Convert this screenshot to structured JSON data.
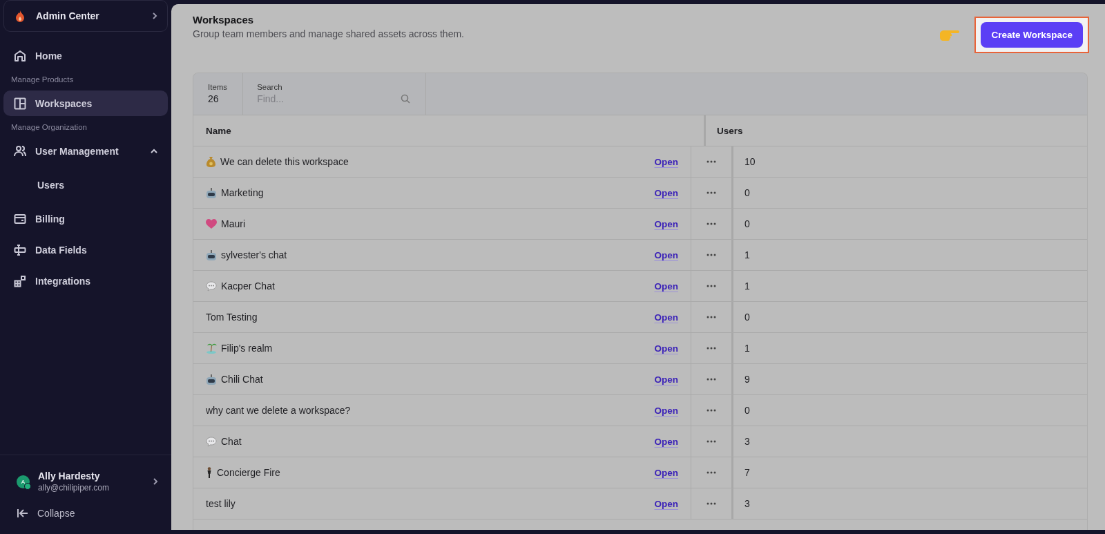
{
  "sidebar": {
    "title": "Admin Center",
    "items": [
      {
        "kind": "home",
        "label": "Home",
        "selected": false
      },
      {
        "kind": "section",
        "label": "Manage Products"
      },
      {
        "kind": "workspaces",
        "label": "Workspaces",
        "selected": true
      },
      {
        "kind": "section",
        "label": "Manage Organization"
      },
      {
        "kind": "users",
        "label": "User Management",
        "selected": false,
        "expanded": true,
        "children": [
          {
            "label": "Users",
            "selected": false
          }
        ]
      },
      {
        "kind": "billing",
        "label": "Billing",
        "selected": false
      },
      {
        "kind": "fields",
        "label": "Data Fields",
        "selected": false
      },
      {
        "kind": "integrations",
        "label": "Integrations",
        "selected": false
      }
    ],
    "user": {
      "initial": "A",
      "name": "Ally Hardesty",
      "email": "ally@chilipiper.com"
    },
    "collapse": "Collapse"
  },
  "page": {
    "title": "Workspaces",
    "subtitle": "Group team members and manage shared assets across them.",
    "create_button": "Create Workspace"
  },
  "toolbar": {
    "items_label": "Items",
    "items_count": "26",
    "search_label": "Search",
    "search_placeholder": "Find..."
  },
  "table": {
    "columns": [
      "Name",
      "Users"
    ],
    "rows": [
      {
        "kind": "moneybag",
        "name": "We can delete this workspace",
        "action": "Open",
        "users": "10"
      },
      {
        "kind": "robot",
        "name": "Marketing",
        "action": "Open",
        "users": "0"
      },
      {
        "kind": "heart",
        "name": "Mauri",
        "action": "Open",
        "users": "0"
      },
      {
        "kind": "robot",
        "name": "sylvester's chat",
        "action": "Open",
        "users": "1"
      },
      {
        "kind": "speech",
        "name": "Kacper Chat",
        "action": "Open",
        "users": "1"
      },
      {
        "kind": "plain",
        "name": "Tom Testing",
        "action": "Open",
        "users": "0"
      },
      {
        "kind": "island",
        "name": "Filip's realm",
        "action": "Open",
        "users": "1"
      },
      {
        "kind": "robot",
        "name": "Chili Chat",
        "action": "Open",
        "users": "9"
      },
      {
        "kind": "plain",
        "name": "why cant we delete a workspace?",
        "action": "Open",
        "users": "0"
      },
      {
        "kind": "speech",
        "name": "Chat",
        "action": "Open",
        "users": "3"
      },
      {
        "kind": "figure",
        "name": "Concierge Fire",
        "action": "Open",
        "users": "7"
      },
      {
        "kind": "plain",
        "name": "test lily",
        "action": "Open",
        "users": "3"
      }
    ]
  }
}
